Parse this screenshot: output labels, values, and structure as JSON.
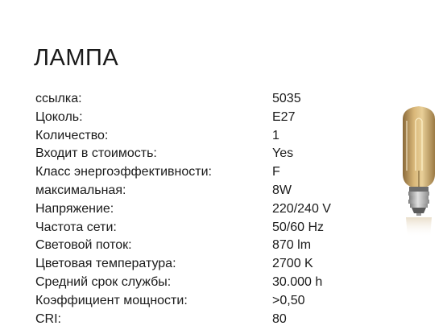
{
  "title": "ЛАМПА",
  "specs": [
    {
      "label": "ссылка:",
      "value": "5035"
    },
    {
      "label": "Цоколь:",
      "value": "E27"
    },
    {
      "label": "Количество:",
      "value": "1"
    },
    {
      "label": "Входит в стоимость:",
      "value": "Yes"
    },
    {
      "label": "Класс энергоэффективности:",
      "value": "F"
    },
    {
      "label": "максимальная:",
      "value": "8W"
    },
    {
      "label": "Напряжение:",
      "value": "220/240 V"
    },
    {
      "label": "Частота сети:",
      "value": "50/60 Hz"
    },
    {
      "label": "Световой поток:",
      "value": "870 lm"
    },
    {
      "label": "Цветовая температура:",
      "value": "2700 K"
    },
    {
      "label": "Средний срок службы:",
      "value": "30.000 h"
    },
    {
      "label": "Коэффициент мощности:",
      "value": ">0,50"
    },
    {
      "label": "CRI:",
      "value": "80"
    }
  ],
  "colors": {
    "text": "#1a1a1a",
    "background": "#ffffff",
    "bulb_glass": "#c9a56a",
    "bulb_base": "#b0b0b0"
  }
}
